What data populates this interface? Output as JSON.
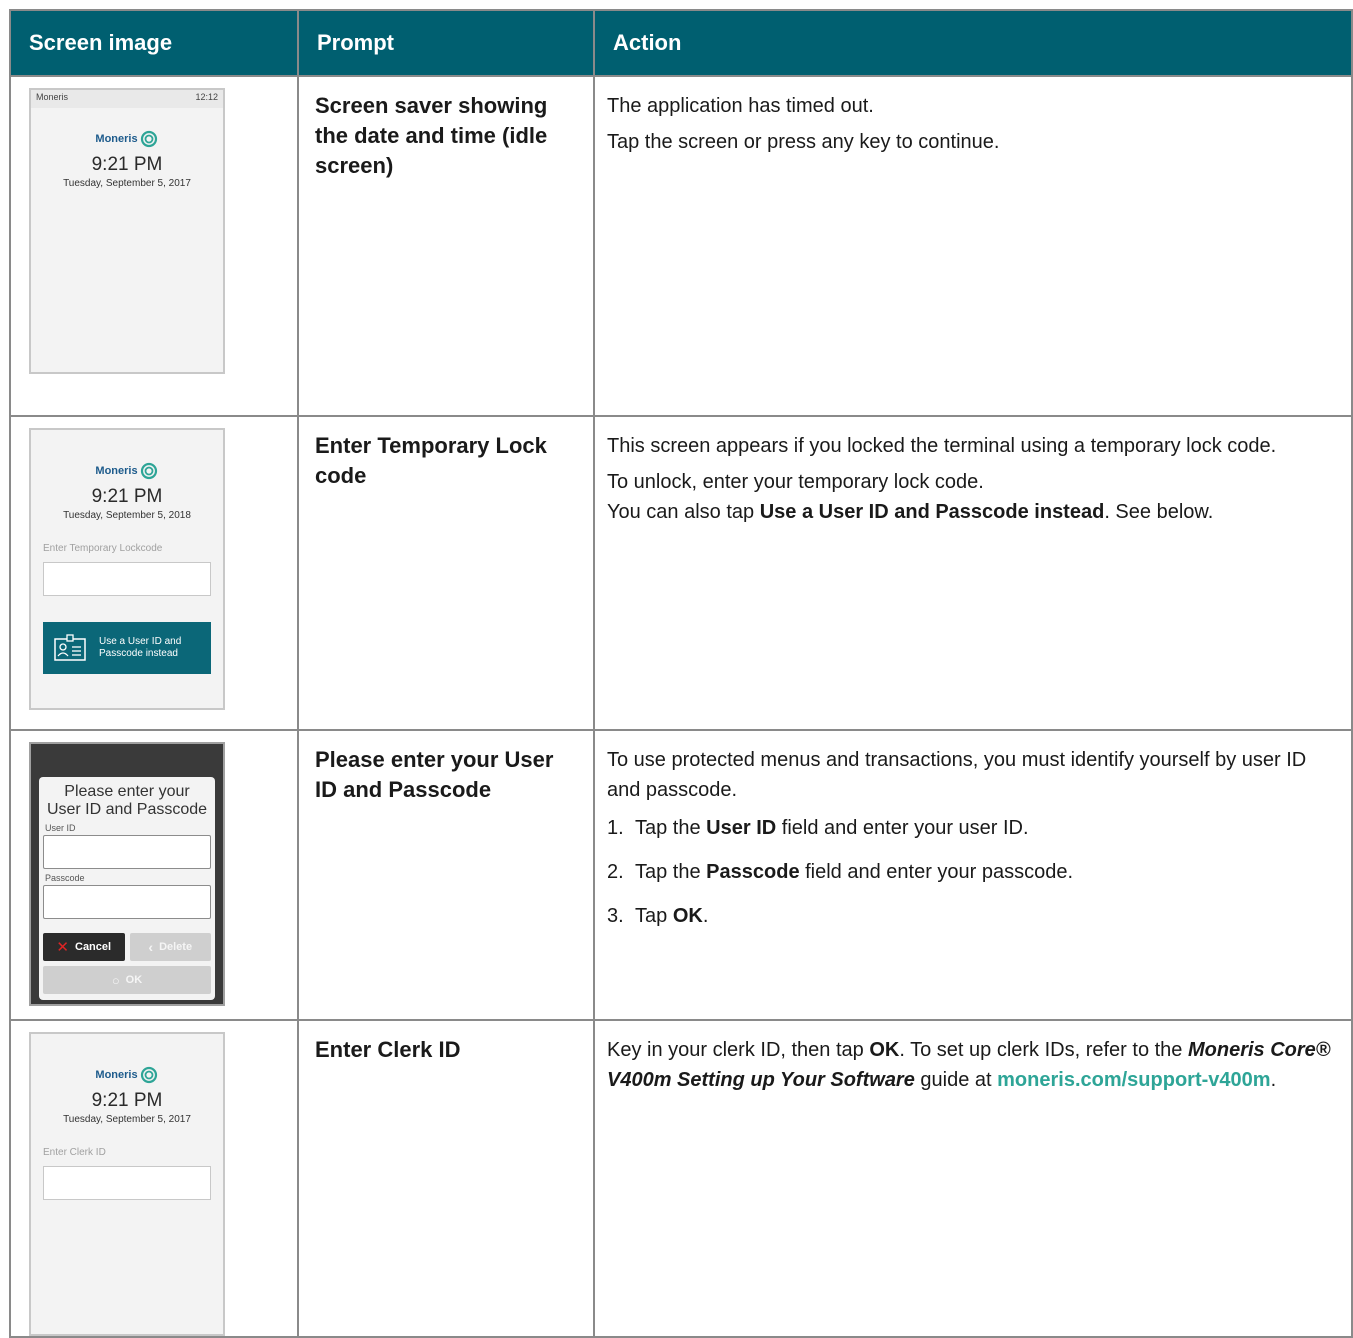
{
  "headers": [
    "Screen image",
    "Prompt",
    "Action"
  ],
  "rows": [
    {
      "prompt": "Screen saver showing the date and time (idle screen)",
      "action_lines": [
        "The application has timed out.",
        "Tap the screen or press any key to continue."
      ],
      "screen": {
        "status_left": "Moneris",
        "status_right": "12:12",
        "brand": "Moneris",
        "time": "9:21 PM",
        "date": "Tuesday, September 5, 2017"
      }
    },
    {
      "prompt": "Enter Temporary Lock code",
      "action": {
        "line1": "This screen appears if you locked the terminal using a temporary lock code.",
        "line2": "To unlock, enter your temporary lock code.",
        "line3_pre": "You can also tap ",
        "line3_bold": "Use a User ID and Passcode instead",
        "line3_post": ". See below."
      },
      "screen": {
        "brand": "Moneris",
        "time": "9:21 PM",
        "date": "Tuesday, September 5, 2018",
        "field_label": "Enter Temporary Lockcode",
        "button_line1": "Use a User ID and",
        "button_line2": "Passcode instead"
      }
    },
    {
      "prompt": "Please enter your User ID and Passcode",
      "action": {
        "intro": "To use protected menus and transactions, you must identify yourself by user ID and passcode.",
        "steps": [
          {
            "num": "1.",
            "pre": "Tap the ",
            "bold": "User ID",
            "post": " field and enter your user ID."
          },
          {
            "num": "2.",
            "pre": "Tap the ",
            "bold": "Passcode",
            "post": " field and enter your passcode."
          },
          {
            "num": "3.",
            "pre": "Tap ",
            "bold": "OK",
            "post": "."
          }
        ]
      },
      "screen": {
        "title_line1": "Please enter your",
        "title_line2": "User ID and Passcode",
        "user_label": "User ID",
        "pass_label": "Passcode",
        "cancel": "Cancel",
        "delete": "Delete",
        "ok": "OK"
      }
    },
    {
      "prompt": "Enter Clerk ID",
      "action": {
        "pre": "Key in your clerk ID, then tap ",
        "ok": "OK",
        "mid": ". To set up clerk IDs, refer to the ",
        "guide": "Moneris Core® V400m Setting up Your Software",
        "post": " guide at ",
        "link": "moneris.com/support-v400m",
        "end": "."
      },
      "screen": {
        "brand": "Moneris",
        "time": "9:21 PM",
        "date": "Tuesday, September 5, 2017",
        "field_label": "Enter Clerk ID"
      }
    }
  ],
  "colors": {
    "header_bg": "#005f70",
    "teal_button": "#0b6778",
    "link": "#2ea597",
    "cancel_x": "#e02424"
  },
  "icons": [
    "moneris-logo-icon",
    "id-card-icon",
    "close-icon",
    "chevron-left-icon",
    "circle-icon"
  ]
}
